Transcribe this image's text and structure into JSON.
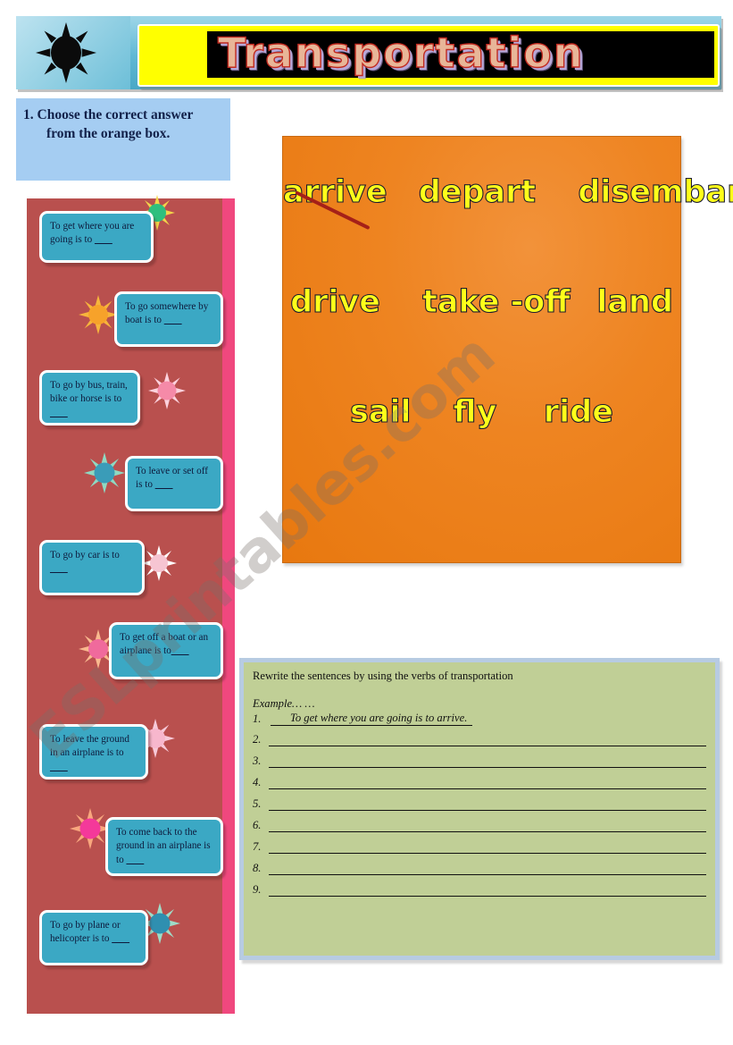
{
  "header": {
    "title": "Transportation",
    "sun_icon": "sun-icon"
  },
  "instruction": {
    "number": "1.",
    "text": "1.  Choose  the correct answer from the orange box."
  },
  "word_bank": {
    "rows": [
      "arrive  depart   disembark",
      "drive     take -off  land",
      "sail     fly   ride"
    ],
    "words": [
      "arrive",
      "depart",
      "disembark",
      "drive",
      "take -off",
      "land",
      "sail",
      "fly",
      "ride"
    ],
    "struck_word": "arrive"
  },
  "bubbles": [
    {
      "text": "To get where you are going is to ___",
      "sun_color": "#2fbf7e"
    },
    {
      "text": "To go somewhere by boat is to ___",
      "sun_color": "#f7a22a"
    },
    {
      "text": "To go by bus, train, bike or horse is to ___",
      "sun_color": "#f58aa8"
    },
    {
      "text": "To leave or set off is to ___",
      "sun_color": "#3a9cb8"
    },
    {
      "text": "To go by car is to ___",
      "sun_color": "#f6c5d2"
    },
    {
      "text": "To get off a boat or an airplane is to___",
      "sun_color": "#f06a9c"
    },
    {
      "text": "To leave the ground in an airplane is to ___",
      "sun_color": "#f7b7cd"
    },
    {
      "text": "To come back to the ground in an airplane is to ___",
      "sun_color": "#f4399a"
    },
    {
      "text": "To go by plane or helicopter is to ___",
      "sun_color": "#2f8fb0"
    }
  ],
  "exercise": {
    "instruction": "Rewrite the sentences by using the verbs of transportation",
    "example_label": "Example… …",
    "example_number": "1.",
    "example_answer": "To get where you are going is to arrive.",
    "line_numbers": [
      "2.",
      "3.",
      "4.",
      "5.",
      "6.",
      "7.",
      "8.",
      "9."
    ]
  },
  "watermark": {
    "text": "ESLprintables.com"
  },
  "colors": {
    "header_teal": "#5fb8d4",
    "banner_yellow": "#ffff00",
    "title_fill": "#e8b698",
    "title_outline": "#c12a20",
    "instruction_blue": "#a5cdf2",
    "rose_panel": "#b9504e",
    "rose_stripe": "#f0487e",
    "bubble_blue": "#3ba8c4",
    "bubble_accent": "#f7cf52",
    "orange_box": "#ee8421",
    "word_yellow": "#ffff1a",
    "strike_red": "#a52018",
    "green_box": "#c0cf96",
    "green_border": "#b7cbe2"
  }
}
